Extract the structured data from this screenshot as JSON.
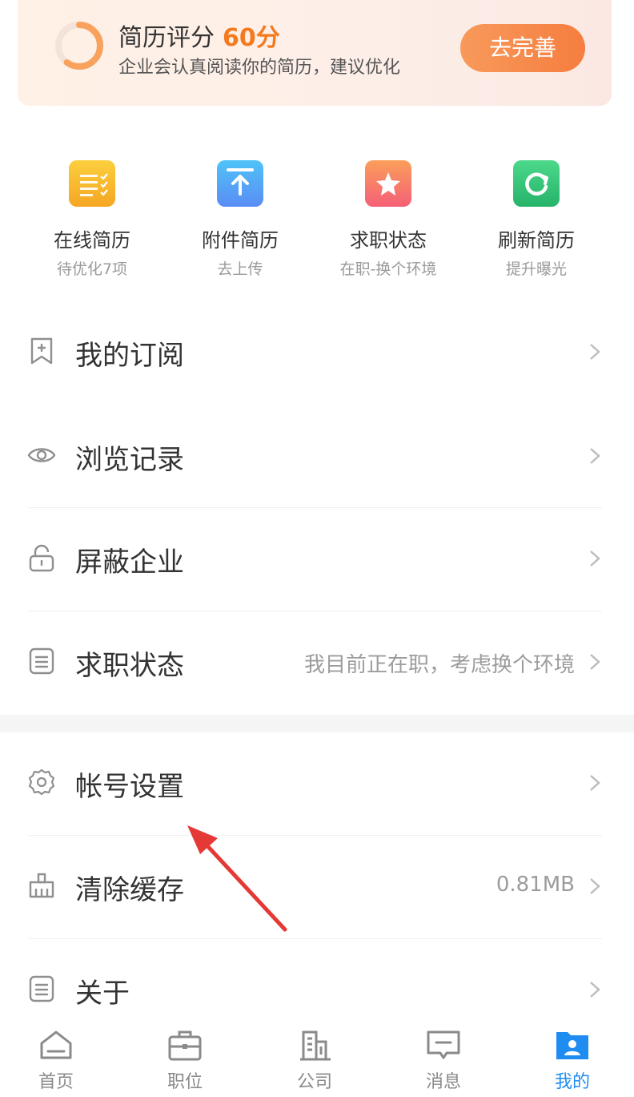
{
  "score_card": {
    "title": "简历评分",
    "score": "60分",
    "subtitle": "企业会认真阅读你的简历，建议优化",
    "button": "去完善",
    "score_percent": 60
  },
  "quick_actions": [
    {
      "label": "在线简历",
      "sub": "待优化7项",
      "icon": "online-resume-icon",
      "color": "#f7b52d"
    },
    {
      "label": "附件简历",
      "sub": "去上传",
      "icon": "upload-icon",
      "color": "#3aa3f3"
    },
    {
      "label": "求职状态",
      "sub": "在职-换个环境",
      "icon": "star-icon",
      "color": "#f6646c"
    },
    {
      "label": "刷新简历",
      "sub": "提升曝光",
      "icon": "refresh-icon",
      "color": "#36c77a"
    }
  ],
  "menu": [
    {
      "label": "我的订阅",
      "value": "",
      "icon": "bookmark-icon"
    },
    {
      "label": "浏览记录",
      "value": "",
      "icon": "eye-icon"
    },
    {
      "label": "屏蔽企业",
      "value": "",
      "icon": "lock-icon"
    },
    {
      "label": "求职状态",
      "value": "我目前正在职，考虑换个环境",
      "icon": "document-icon"
    },
    {
      "label": "帐号设置",
      "value": "",
      "icon": "gear-icon"
    },
    {
      "label": "清除缓存",
      "value": "0.81MB",
      "icon": "broom-icon"
    },
    {
      "label": "关于",
      "value": "",
      "icon": "info-document-icon"
    }
  ],
  "tabs": [
    {
      "label": "首页",
      "icon": "home-icon",
      "active": false
    },
    {
      "label": "职位",
      "icon": "briefcase-icon",
      "active": false
    },
    {
      "label": "公司",
      "icon": "building-icon",
      "active": false
    },
    {
      "label": "消息",
      "icon": "message-icon",
      "active": false
    },
    {
      "label": "我的",
      "icon": "profile-icon",
      "active": true
    }
  ],
  "colors": {
    "accent_orange": "#f47a1f",
    "active_blue": "#1f8cf2",
    "annotation_red": "#e53935"
  }
}
